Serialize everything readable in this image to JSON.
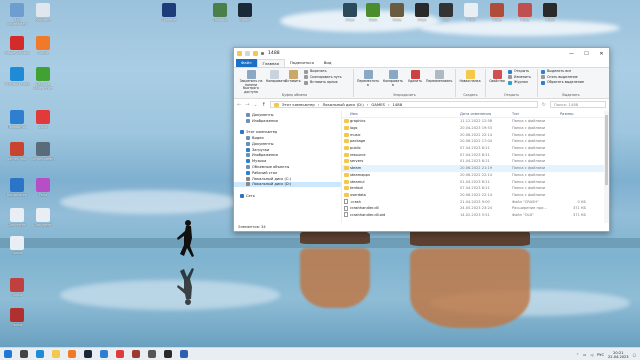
{
  "desktop": {
    "icons_left": [
      {
        "label": "Мой компьютер",
        "color": "#6d9ecf"
      },
      {
        "label": "Корзина",
        "color": "#dfe6ee"
      },
      {
        "label": "Adobe Acrobat",
        "color": "#d32a2a"
      },
      {
        "label": "Firefox",
        "color": "#f07a2a"
      },
      {
        "label": "Microsoft Edge",
        "color": "#1f8ad6"
      },
      {
        "label": "GeForce Experience",
        "color": "#3fa232"
      },
      {
        "label": "Проводник",
        "color": "#2f7fd0"
      },
      {
        "label": "Zona",
        "color": "#e03a3a"
      },
      {
        "label": "games-mail",
        "color": "#c9442e"
      },
      {
        "label": "games-steam",
        "color": "#5a6b7a"
      },
      {
        "label": "Компьютер",
        "color": "#2b75c8"
      },
      {
        "label": "Paint",
        "color": "#b84ec7"
      },
      {
        "label": "Документ",
        "color": "#e8eef4"
      },
      {
        "label": "Документ",
        "color": "#e8eef4"
      },
      {
        "label": "Ярлык",
        "color": "#e8eef4"
      },
      {
        "label": "Ярлык",
        "color": "#c04040"
      },
      {
        "label": "Ярлык",
        "color": "#b03030"
      }
    ],
    "icons_top": [
      {
        "label": "Гпавное",
        "color": "#1d3c7a"
      },
      {
        "label": "Таблица",
        "color": "#4a7f4a"
      },
      {
        "label": "Steam",
        "color": "#1b2838"
      },
      {
        "label": "Игра",
        "color": "#2b4a5c"
      },
      {
        "label": "Xbox",
        "color": "#4b8d2c"
      },
      {
        "label": "Игра",
        "color": "#6a5a40"
      },
      {
        "label": "Игра",
        "color": "#2a2a2a"
      },
      {
        "label": "MSI",
        "color": "#333333"
      },
      {
        "label": "Игра",
        "color": "#e8eef4"
      },
      {
        "label": "Игра",
        "color": "#b04d3a"
      },
      {
        "label": "Игра",
        "color": "#c05050"
      },
      {
        "label": "Игра",
        "color": "#2a2a2a"
      }
    ]
  },
  "explorer": {
    "title": "1488",
    "window_controls": {
      "minimize": "—",
      "maximize": "☐",
      "close": "✕"
    },
    "ribbon_tabs": [
      "Файл",
      "Главная",
      "Поделиться",
      "Вид"
    ],
    "ribbon": {
      "clipboard": {
        "pin": "Закрепить на панели быстрого доступа",
        "copy": "Копировать",
        "paste": "Вставить",
        "cut": "Вырезать",
        "copy_path": "Скопировать путь",
        "paste_shortcut": "Вставить ярлык",
        "group": "Буфер обмена"
      },
      "organize": {
        "move": "Переместить в",
        "copyto": "Копировать в",
        "delete": "Удалить",
        "rename": "Переименовать",
        "group": "Упорядочить"
      },
      "new": {
        "folder": "Новая папка",
        "group": "Создать"
      },
      "open": {
        "properties": "Свойства",
        "open": "Открыть",
        "edit": "Изменить",
        "history": "Журнал",
        "group": "Открыть"
      },
      "select": {
        "all": "Выделить все",
        "none": "Снять выделение",
        "invert": "Обратить выделение",
        "group": "Выделить"
      }
    },
    "address": {
      "path": [
        "Этот компьютер",
        "Локальный диск (D:)",
        "GAMES",
        "1488"
      ],
      "search_placeholder": "Поиск: 1488"
    },
    "nav": [
      {
        "label": "Документы",
        "indent": 1,
        "color": "#6a8fb8"
      },
      {
        "label": "Изображения",
        "indent": 1,
        "color": "#6a8fb8"
      },
      {
        "label": "",
        "indent": 0,
        "color": ""
      },
      {
        "label": "Этот компьютер",
        "indent": 0,
        "color": "#2b75c8"
      },
      {
        "label": "Видео",
        "indent": 1,
        "color": "#6a8fb8"
      },
      {
        "label": "Документы",
        "indent": 1,
        "color": "#6a8fb8"
      },
      {
        "label": "Загрузки",
        "indent": 1,
        "color": "#2f7fd0"
      },
      {
        "label": "Изображения",
        "indent": 1,
        "color": "#6a8fb8"
      },
      {
        "label": "Музыка",
        "indent": 1,
        "color": "#2f7fd0"
      },
      {
        "label": "Объемные объекты",
        "indent": 1,
        "color": "#6a8fb8"
      },
      {
        "label": "Рабочий стол",
        "indent": 1,
        "color": "#2f7fd0"
      },
      {
        "label": "Локальный диск (C:)",
        "indent": 1,
        "color": "#888888"
      },
      {
        "label": "Локальный диск (D:)",
        "indent": 1,
        "color": "#888888",
        "selected": true
      },
      {
        "label": "",
        "indent": 0,
        "color": ""
      },
      {
        "label": "Сеть",
        "indent": 0,
        "color": "#2b75c8"
      }
    ],
    "columns": [
      "Имя",
      "Дата изменения",
      "Тип",
      "Размер"
    ],
    "files": [
      {
        "name": "graphics",
        "date": "11.12.2022 12:58",
        "type": "Папка с файлами",
        "size": "",
        "kind": "folder"
      },
      {
        "name": "logs",
        "date": "20.04.2023 19:53",
        "type": "Папка с файлами",
        "size": "",
        "kind": "folder"
      },
      {
        "name": "music",
        "date": "20.06.2022 22:14",
        "type": "Папка с файлами",
        "size": "",
        "kind": "folder"
      },
      {
        "name": "package",
        "date": "20.06.2022 17:04",
        "type": "Папка с файлами",
        "size": "",
        "kind": "folder"
      },
      {
        "name": "public",
        "date": "07.04.2023 8:21",
        "type": "Папка с файлами",
        "size": "",
        "kind": "folder"
      },
      {
        "name": "resource",
        "date": "07.04.2023 8:21",
        "type": "Папка с файлами",
        "size": "",
        "kind": "folder"
      },
      {
        "name": "servers",
        "date": "01.04.2023 8:21",
        "type": "Папка с файлами",
        "size": "",
        "kind": "folder"
      },
      {
        "name": "steam",
        "date": "20.06.2022 21:19",
        "type": "Папка с файлами",
        "size": "",
        "kind": "folder",
        "hover": true
      },
      {
        "name": "steamapps",
        "date": "20.06.2022 22:14",
        "type": "Папка с файлами",
        "size": "",
        "kind": "folder"
      },
      {
        "name": "steamui",
        "date": "01.04.2023 8:21",
        "type": "Папка с файлами",
        "size": "",
        "kind": "folder"
      },
      {
        "name": "tenfoot",
        "date": "07.04.2023 8:21",
        "type": "Папка с файлами",
        "size": "",
        "kind": "folder"
      },
      {
        "name": "userdata",
        "date": "20.06.2022 22:14",
        "type": "Папка с файлами",
        "size": "",
        "kind": "folder"
      },
      {
        "name": ".crash",
        "date": "21.04.2023 9:00",
        "type": "Файл \"CRASH\"",
        "size": "0 КБ",
        "kind": "file"
      },
      {
        "name": "crashhandler.dll",
        "date": "24.05.2023 23:24",
        "type": "Расширение при...",
        "size": "371 КБ",
        "kind": "file"
      },
      {
        "name": "crashhandler.dll.old",
        "date": "14.02.2023 5:51",
        "type": "Файл \"OLD\"",
        "size": "371 КБ",
        "kind": "file"
      }
    ],
    "status": "Элементов: 34"
  },
  "taskbar": {
    "apps": [
      {
        "name": "start",
        "color": "#1f78d1"
      },
      {
        "name": "search",
        "color": "#444444"
      },
      {
        "name": "edge",
        "color": "#1f8ad6"
      },
      {
        "name": "explorer",
        "color": "#f4c94b"
      },
      {
        "name": "firefox",
        "color": "#f07a2a"
      },
      {
        "name": "steam",
        "color": "#1b2838"
      },
      {
        "name": "photos",
        "color": "#2f7fd0"
      },
      {
        "name": "yandex",
        "color": "#e03a3a"
      },
      {
        "name": "game",
        "color": "#9b3b2f"
      },
      {
        "name": "settings",
        "color": "#555555"
      },
      {
        "name": "terminal",
        "color": "#2a2a2a"
      },
      {
        "name": "word",
        "color": "#2b5fb0"
      }
    ],
    "lang": "РУС",
    "time": "20:21",
    "date": "22.04.2023"
  }
}
